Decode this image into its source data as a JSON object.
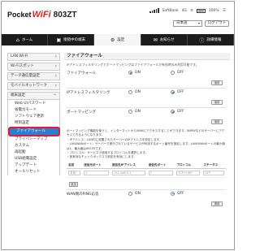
{
  "header": {
    "brand": "Pocket",
    "brand_wifi": "WiFi",
    "model": "803ZT",
    "carrier": "SoftBank",
    "network": "4G",
    "battery": "100%",
    "language": "日本語",
    "logout": "ログアウト"
  },
  "nav": {
    "tabs": [
      {
        "label": "ホーム",
        "icon": "home-icon",
        "glyph": "⌂"
      },
      {
        "label": "接続中の端末",
        "icon": "devices-icon",
        "glyph": "▣"
      },
      {
        "label": "設定",
        "icon": "gear-icon",
        "glyph": "⚙"
      },
      {
        "label": "お知らせ",
        "icon": "mail-icon",
        "glyph": "✉"
      },
      {
        "label": "詳細情報",
        "icon": "info-icon",
        "glyph": "ⓘ"
      }
    ]
  },
  "sidebar": {
    "items": [
      "LAN Wi-Fi",
      "Wi-Fiスポット",
      "データ通信量設定",
      "モバイルネットワーク",
      "端末設定"
    ],
    "subitems": [
      "Web UIパスワード",
      "省電力モード",
      "ソフトウェア更新",
      "時刻設定",
      "ファイアウォール",
      "プライバシーマップ",
      "カスタム",
      "再起動",
      "USB給電設定",
      "アップデート",
      "オールリセット"
    ],
    "active_sub": "ファイアウォール"
  },
  "main": {
    "title": "ファイアウォール",
    "description": "IPアドレスフィルタリングとポートマッピングはファイアウォールが有効時のみ利用可能です。",
    "on": "ON",
    "off": "OFF",
    "apply": "適用",
    "firewall_label": "ファイアウォール",
    "ipfilter_label": "IPアドレスフィルタリング",
    "portmap_label": "ポートマッピング",
    "note_1": "ポートマッピング機能を使うと、インターネットからWANにアクセスすることができます。WWWなどのサーバーにアクセスできるようになります。",
    "note_2": "・IPアドレス：LAN内に設置されたサーバーのIPアドレスを設定します。",
    "note_3": "・LAN/WANポート：サーバーで実行されているサービスが利用するポート番号を指定します。LAN/WANポートの最小値は1、最大値は65535です。",
    "note_4": "・プロトコル：サービスで使用するプロトコルを選択します。",
    "note_5": "・各有効なチェックボックスで設定を有効にします。",
    "table_headers": [
      "名前",
      "送信元ポート",
      "送信先IPアドレス",
      "送信先ポート",
      "プロトコル",
      "ステータス"
    ],
    "table_row": [
      "名前",
      "1",
      "192.168.0.1",
      "1",
      "TCP+UDP",
      "OFF"
    ],
    "add": "追加",
    "wan_ping_label": "WAN側のPING応答"
  }
}
